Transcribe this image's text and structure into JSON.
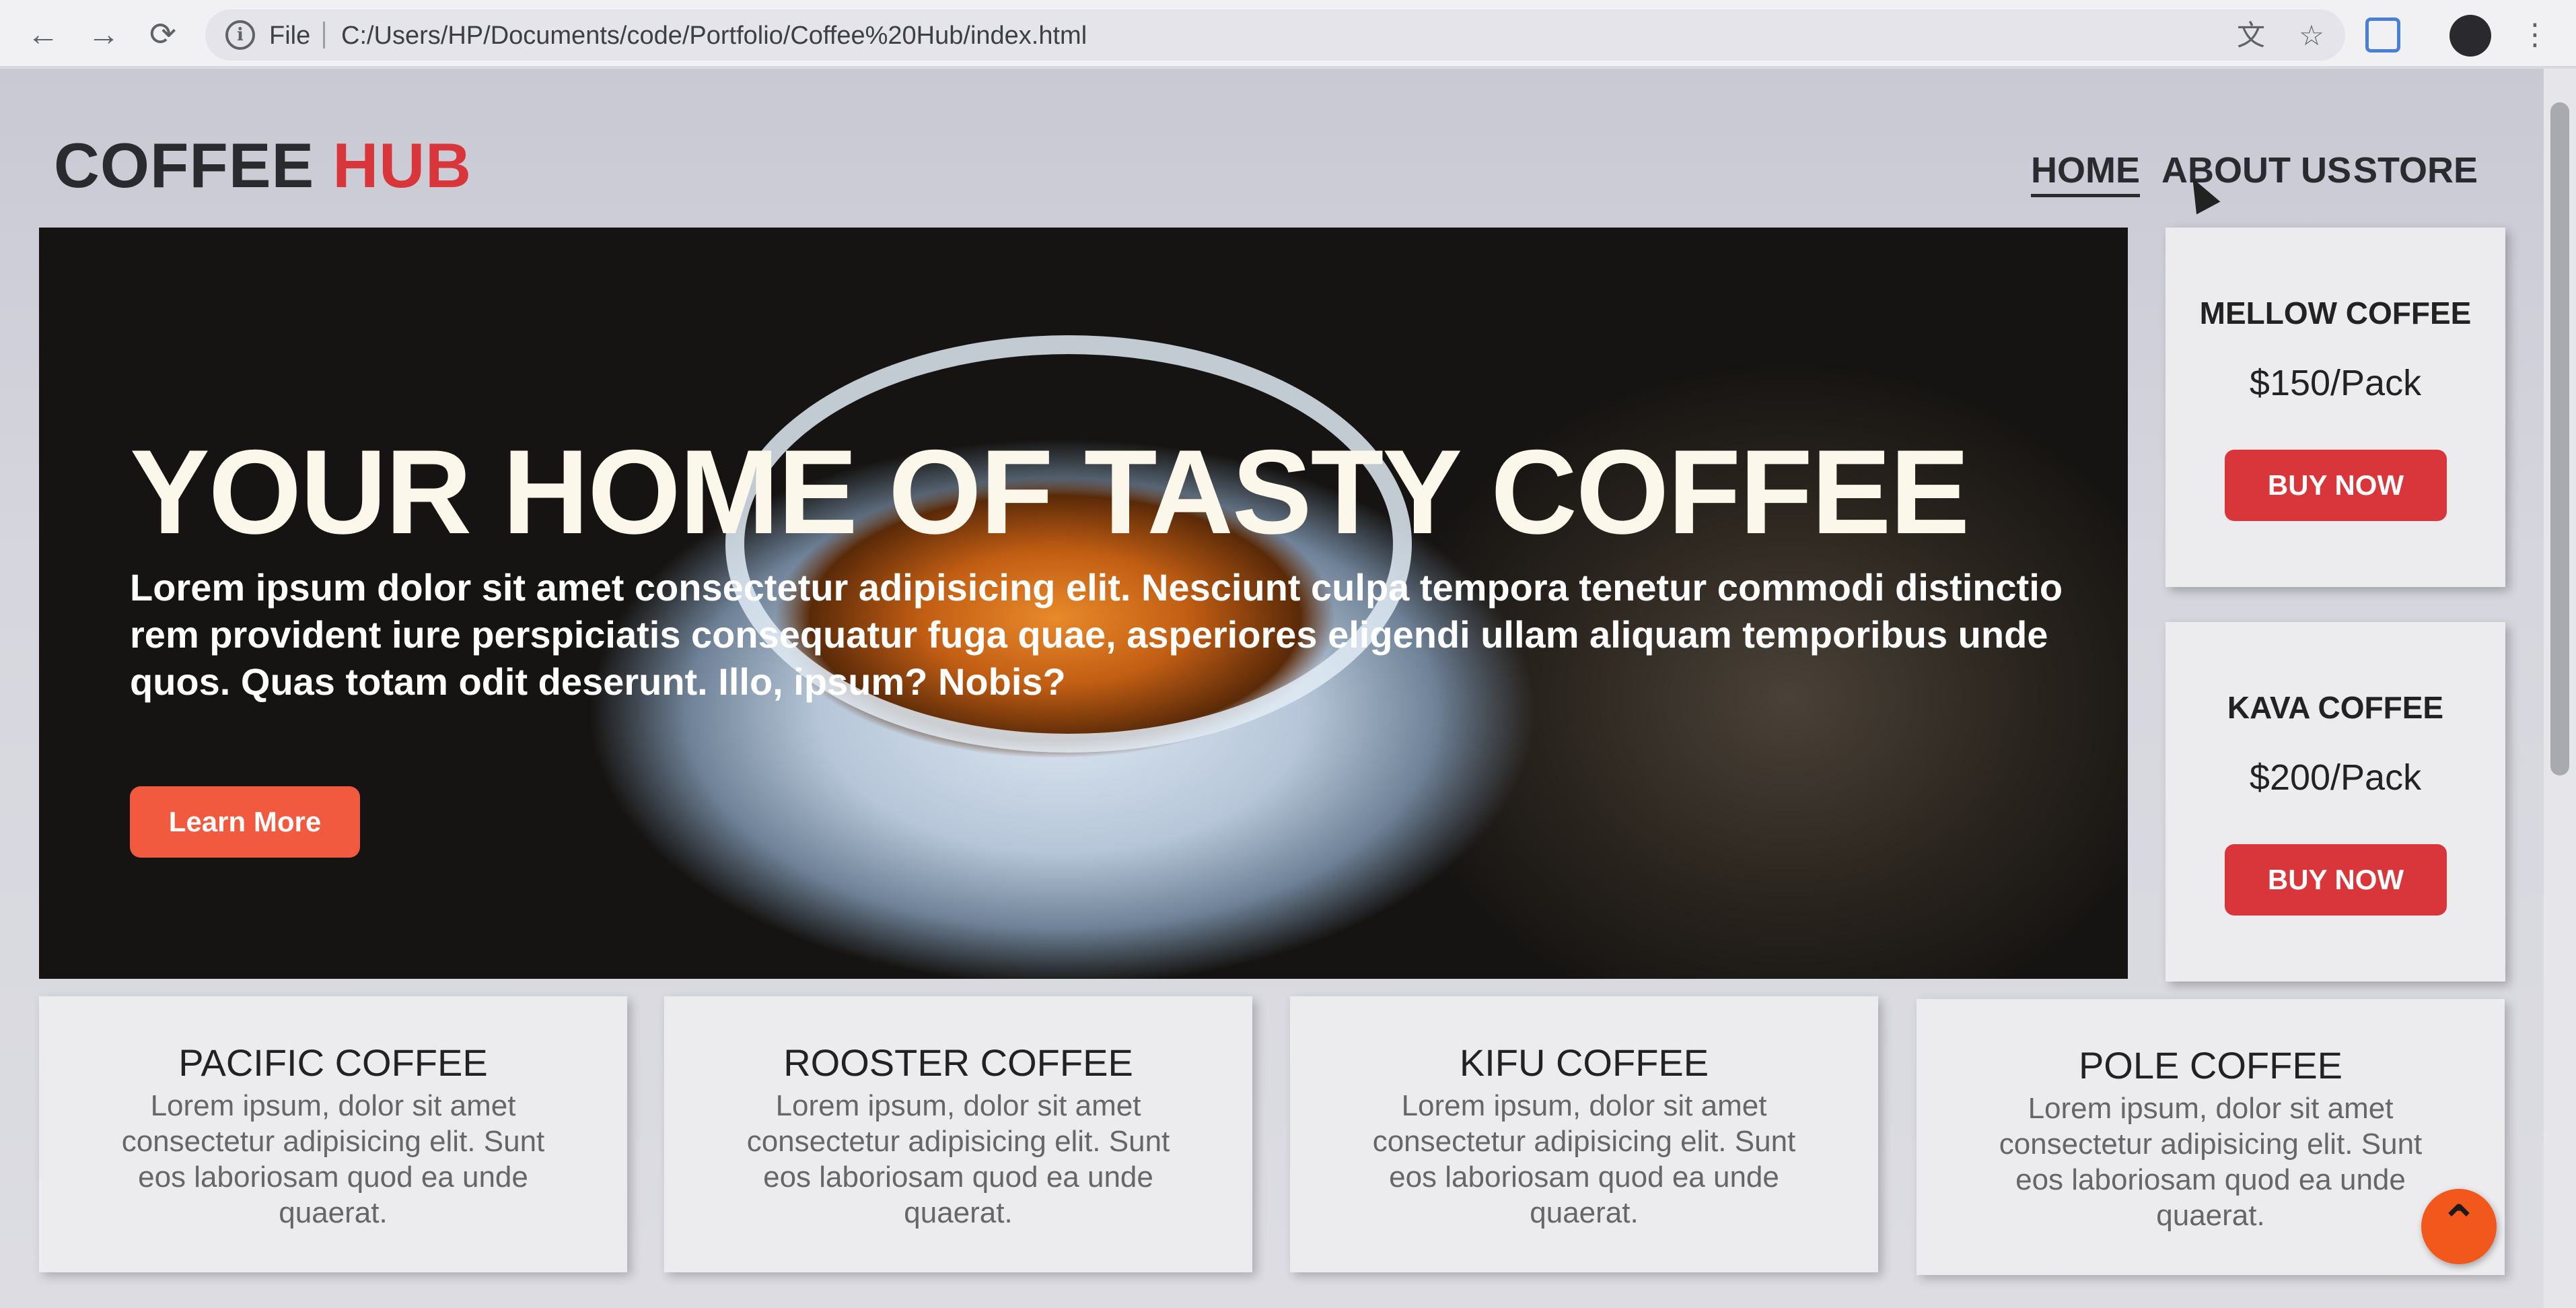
{
  "browser": {
    "back_icon": "←",
    "forward_icon": "→",
    "reload_icon": "⟳",
    "info_icon": "i",
    "file_label": "File",
    "url": "C:/Users/HP/Documents/code/Portfolio/Coffee%20Hub/index.html",
    "translate_icon": "文",
    "bookmark_icon": "☆",
    "menu_icon": "⋮"
  },
  "site": {
    "logo_part1": "COFFEE",
    "logo_part2": "HUB",
    "nav": [
      "HOME",
      "ABOUT US",
      "STORE"
    ],
    "active_nav": "HOME"
  },
  "hero": {
    "title": "YOUR HOME OF TASTY COFFEE",
    "description": "Lorem ipsum dolor sit amet consectetur adipisicing elit. Nesciunt culpa tempora tenetur commodi distinctio rem provident iure perspiciatis consequatur fuga quae, asperiores eligendi ullam aliquam temporibus unde quos. Quas totam odit deserunt. Illo, ipsum? Nobis?",
    "button": "Learn More"
  },
  "side_products": [
    {
      "name": "MELLOW COFFEE",
      "price": "$150/Pack",
      "button": "BUY NOW"
    },
    {
      "name": "KAVA COFFEE",
      "price": "$200/Pack",
      "button": "BUY NOW"
    }
  ],
  "products": [
    {
      "name": "PACIFIC COFFEE",
      "desc": "Lorem ipsum, dolor sit amet consectetur adipisicing elit. Sunt eos laboriosam quod ea unde quaerat."
    },
    {
      "name": "ROOSTER COFFEE",
      "desc": "Lorem ipsum, dolor sit amet consectetur adipisicing elit. Sunt eos laboriosam quod ea unde quaerat."
    },
    {
      "name": "KIFU COFFEE",
      "desc": "Lorem ipsum, dolor sit amet consectetur adipisicing elit. Sunt eos laboriosam quod ea unde quaerat."
    },
    {
      "name": "POLE COFFEE",
      "desc": "Lorem ipsum, dolor sit amet consectetur adipisicing elit. Sunt eos laboriosam quod ea unde quaerat."
    }
  ],
  "scroll_top_icon": "⌃",
  "colors": {
    "accent_red": "#d8363a",
    "learn_more_orange": "#f15a3f",
    "scroll_top_orange": "#f2571b"
  }
}
